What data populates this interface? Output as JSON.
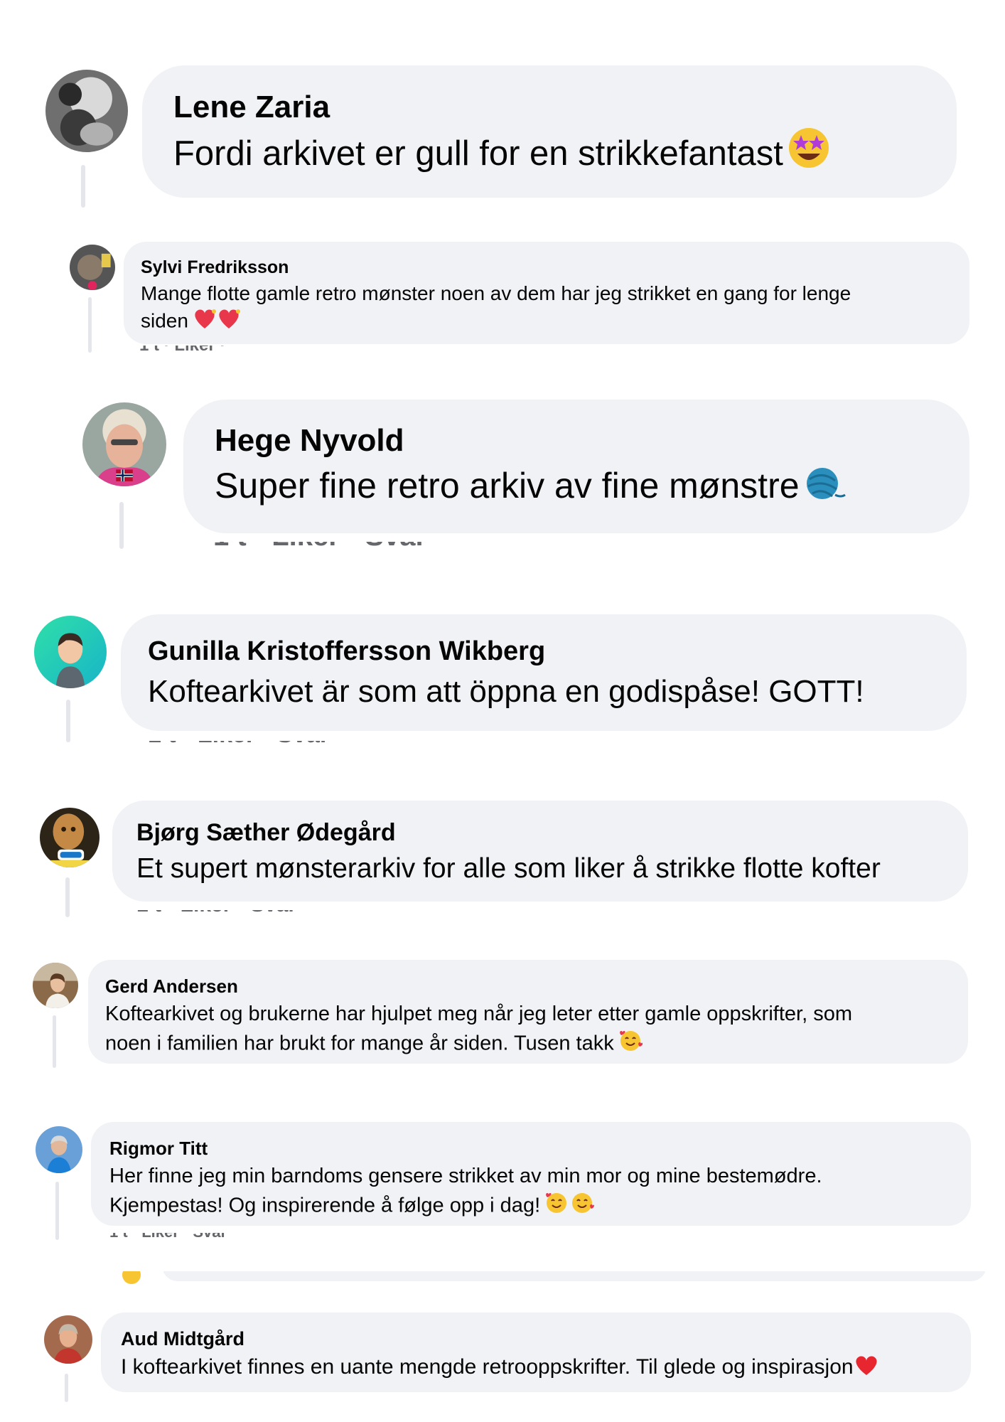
{
  "comments": [
    {
      "name": "Lene Zaria",
      "text": "Fordi arkivet er gull for en strikkefantast",
      "emoji": "star-struck-emoji"
    },
    {
      "name": "Sylvi Fredriksson",
      "text": "Mange flotte gamle retro mønster noen av dem har jeg strikket en gang for lenge\nsiden",
      "emoji": "sparkling-heart-emoji"
    },
    {
      "name": "Hege Nyvold",
      "text": "Super fine retro arkiv av fine mønstre",
      "emoji": "yarn-emoji"
    },
    {
      "name": "Gunilla Kristoffersson Wikberg",
      "text": "Koftearkivet är som att öppna en godispåse! GOTT!"
    },
    {
      "name": "Bjørg Sæther Ødegård",
      "text": "Et supert mønsterarkiv for alle som liker å strikke flotte kofter"
    },
    {
      "name": "Gerd Andersen",
      "text": "Koftearkivet og brukerne har hjulpet meg når jeg leter etter gamle oppskrifter, som\nnoen i familien har brukt for mange år siden. Tusen takk",
      "emoji": "smiling-face-with-hearts-emoji"
    },
    {
      "name": "Rigmor Titt",
      "text": "Her finne jeg min barndoms gensere strikket av min mor og mine bestemødre.\nKjempestas! Og inspirerende å følge opp i dag!",
      "emoji": "smiling-face-with-hearts-emoji"
    },
    {
      "name": "Aud Midtgård",
      "text": "I koftearkivet finnes en uante mengde retrooppskrifter. Til glede og inspirasjon",
      "emoji": "red-heart-emoji"
    }
  ],
  "colors": {
    "bubble": "#f0f2f5",
    "thread_line": "#e4e6eb",
    "text": "#050505",
    "meta": "#65676b"
  }
}
